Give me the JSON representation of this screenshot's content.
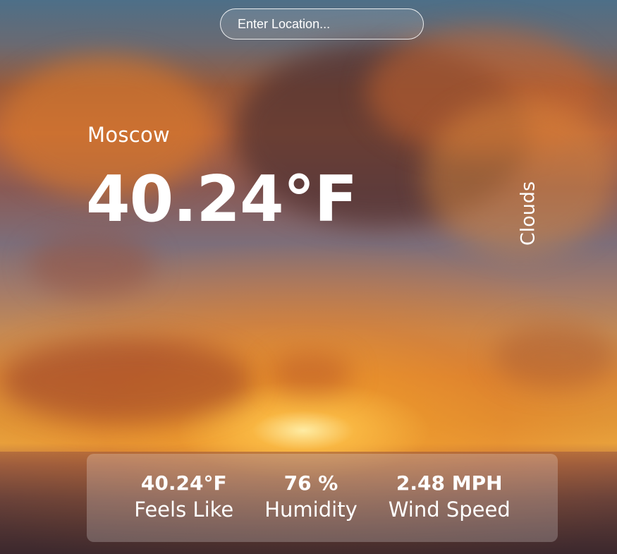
{
  "search": {
    "placeholder": "Enter Location...",
    "value": ""
  },
  "weather": {
    "location": "Moscow",
    "temperature": "40.24°F",
    "condition": "Clouds"
  },
  "stats": [
    {
      "value": "40.24°F",
      "label": "Feels Like"
    },
    {
      "value": "76 %",
      "label": "Humidity"
    },
    {
      "value": "2.48 MPH",
      "label": "Wind Speed"
    }
  ],
  "colors": {
    "text": "#ffffff",
    "panel": "rgba(255,255,255,0.22)"
  }
}
